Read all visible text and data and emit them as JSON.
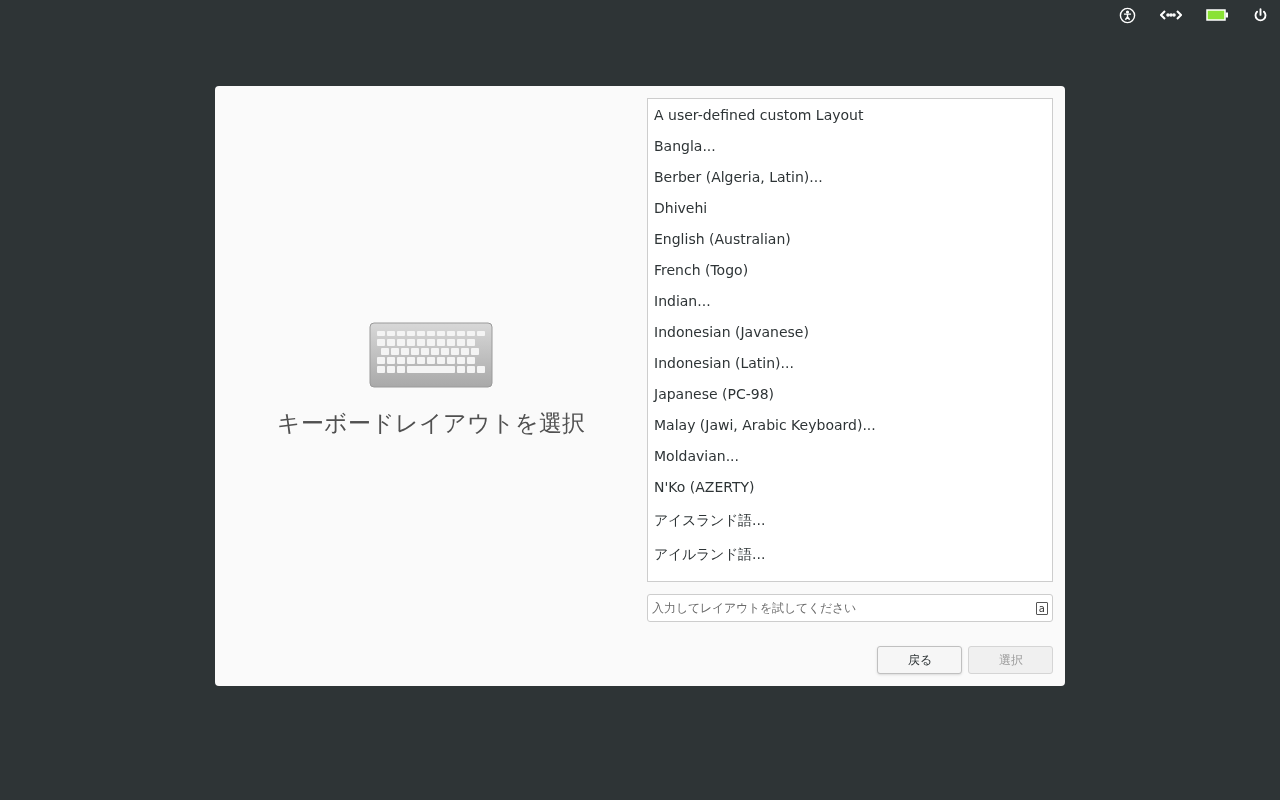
{
  "dialog": {
    "title": "キーボードレイアウトを選択"
  },
  "layouts": [
    {
      "label": "A user-defined custom Layout",
      "selected": false
    },
    {
      "label": "Bangla...",
      "selected": false
    },
    {
      "label": "Berber (Algeria, Latin)...",
      "selected": false
    },
    {
      "label": "Dhivehi",
      "selected": false
    },
    {
      "label": "English (Australian)",
      "selected": false
    },
    {
      "label": "French (Togo)",
      "selected": false
    },
    {
      "label": "Indian...",
      "selected": false
    },
    {
      "label": "Indonesian (Javanese)",
      "selected": false
    },
    {
      "label": "Indonesian (Latin)...",
      "selected": false
    },
    {
      "label": "Japanese (PC-98)",
      "selected": false
    },
    {
      "label": "Malay (Jawi, Arabic Keyboard)...",
      "selected": false
    },
    {
      "label": "Moldavian...",
      "selected": false
    },
    {
      "label": "N'Ko (AZERTY)",
      "selected": false
    },
    {
      "label": "アイスランド語...",
      "selected": false
    },
    {
      "label": "アイルランド語...",
      "selected": false
    }
  ],
  "test_field": {
    "placeholder": "入力してレイアウトを試してください",
    "indicator": "a"
  },
  "buttons": [
    {
      "label": "戻る",
      "disabled": false
    },
    {
      "label": "選択",
      "disabled": true
    }
  ]
}
